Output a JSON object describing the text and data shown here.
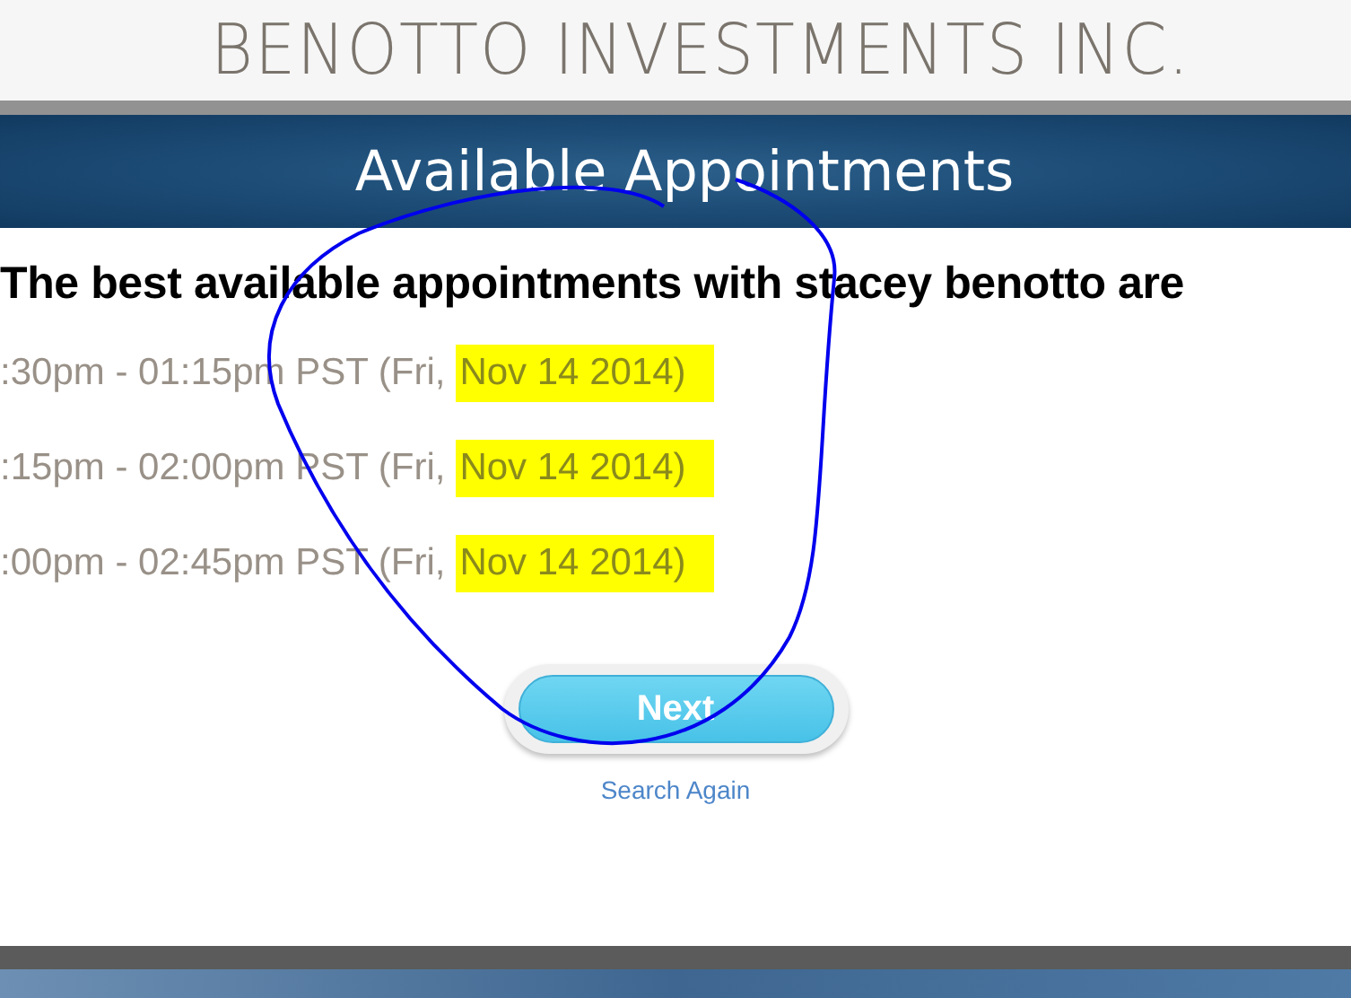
{
  "company": {
    "name": "BENOTTO INVESTMENTS INC."
  },
  "banner": {
    "title": "Available Appointments"
  },
  "heading": "The best available appointments with stacey benotto are",
  "slots": [
    {
      "time": ":30pm - 01:15pm PST (Fri,",
      "date": "Nov 14 2014)",
      "highlighted": true
    },
    {
      "time": ":15pm - 02:00pm PST (Fri,",
      "date": "Nov 14 2014)",
      "highlighted": true
    },
    {
      "time": ":00pm - 02:45pm PST (Fri,",
      "date": "Nov 14 2014)",
      "highlighted": true
    }
  ],
  "next_button": "Next",
  "search_again_link": "Search Again"
}
